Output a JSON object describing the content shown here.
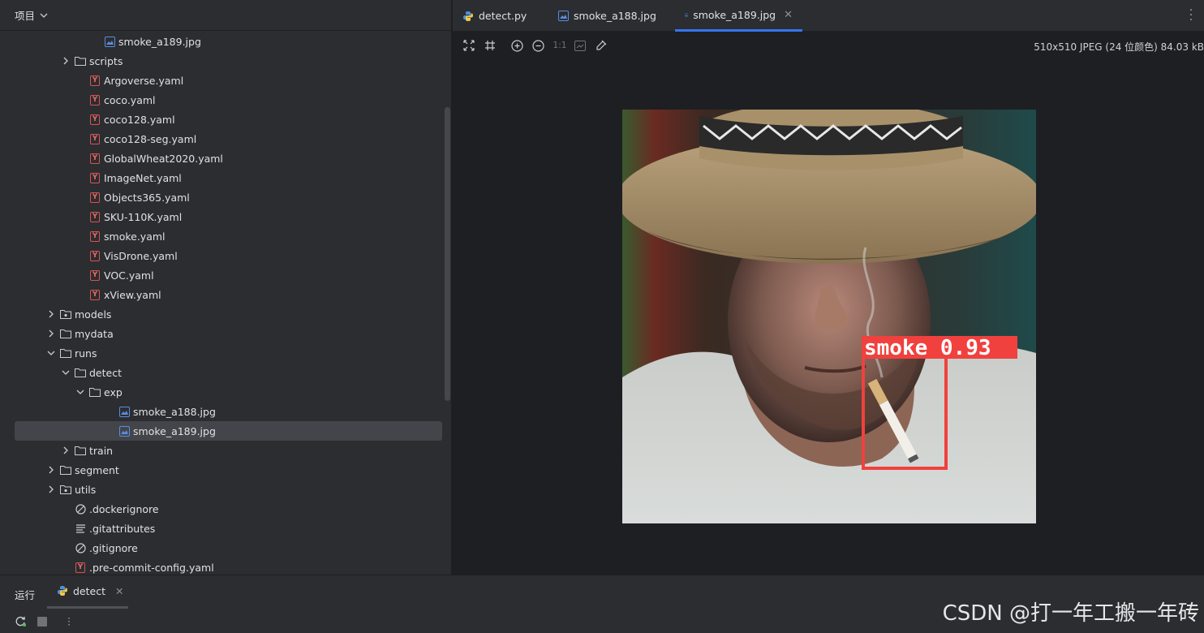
{
  "project_panel": {
    "title": "项目",
    "tree": [
      {
        "label": "smoke_a189.jpg",
        "type": "image",
        "depth": 5,
        "arrow": "none"
      },
      {
        "label": "scripts",
        "type": "folder",
        "depth": 3,
        "arrow": "right"
      },
      {
        "label": "Argoverse.yaml",
        "type": "yaml",
        "depth": 4,
        "arrow": "none"
      },
      {
        "label": "coco.yaml",
        "type": "yaml",
        "depth": 4,
        "arrow": "none"
      },
      {
        "label": "coco128.yaml",
        "type": "yaml",
        "depth": 4,
        "arrow": "none"
      },
      {
        "label": "coco128-seg.yaml",
        "type": "yaml",
        "depth": 4,
        "arrow": "none"
      },
      {
        "label": "GlobalWheat2020.yaml",
        "type": "yaml",
        "depth": 4,
        "arrow": "none"
      },
      {
        "label": "ImageNet.yaml",
        "type": "yaml",
        "depth": 4,
        "arrow": "none"
      },
      {
        "label": "Objects365.yaml",
        "type": "yaml",
        "depth": 4,
        "arrow": "none"
      },
      {
        "label": "SKU-110K.yaml",
        "type": "yaml",
        "depth": 4,
        "arrow": "none"
      },
      {
        "label": "smoke.yaml",
        "type": "yaml",
        "depth": 4,
        "arrow": "none"
      },
      {
        "label": "VisDrone.yaml",
        "type": "yaml",
        "depth": 4,
        "arrow": "none"
      },
      {
        "label": "VOC.yaml",
        "type": "yaml",
        "depth": 4,
        "arrow": "none"
      },
      {
        "label": "xView.yaml",
        "type": "yaml",
        "depth": 4,
        "arrow": "none"
      },
      {
        "label": "models",
        "type": "package",
        "depth": 2,
        "arrow": "right"
      },
      {
        "label": "mydata",
        "type": "folder",
        "depth": 2,
        "arrow": "right"
      },
      {
        "label": "runs",
        "type": "folder",
        "depth": 2,
        "arrow": "down"
      },
      {
        "label": "detect",
        "type": "folder",
        "depth": 3,
        "arrow": "down"
      },
      {
        "label": "exp",
        "type": "folder",
        "depth": 4,
        "arrow": "down"
      },
      {
        "label": "smoke_a188.jpg",
        "type": "image",
        "depth": 6,
        "arrow": "none"
      },
      {
        "label": "smoke_a189.jpg",
        "type": "image",
        "depth": 6,
        "arrow": "none",
        "selected": true
      },
      {
        "label": "train",
        "type": "folder",
        "depth": 3,
        "arrow": "right"
      },
      {
        "label": "segment",
        "type": "folder",
        "depth": 2,
        "arrow": "right"
      },
      {
        "label": "utils",
        "type": "package",
        "depth": 2,
        "arrow": "right"
      },
      {
        "label": ".dockerignore",
        "type": "ignore",
        "depth": 3,
        "arrow": "none"
      },
      {
        "label": ".gitattributes",
        "type": "text",
        "depth": 3,
        "arrow": "none"
      },
      {
        "label": ".gitignore",
        "type": "ignore",
        "depth": 3,
        "arrow": "none"
      },
      {
        "label": ".pre-commit-config.yaml",
        "type": "yaml",
        "depth": 3,
        "arrow": "none"
      }
    ]
  },
  "editor": {
    "tabs": [
      {
        "label": "detect.py",
        "icon": "python-icon",
        "active": false
      },
      {
        "label": "smoke_a188.jpg",
        "icon": "image-file-icon",
        "active": false
      },
      {
        "label": "smoke_a189.jpg",
        "icon": "image-file-icon",
        "active": true
      }
    ],
    "image_info": "510x510 JPEG (24 位颜色) 84.03 kB",
    "zoom_actual_label": "1:1",
    "detection": {
      "label": "smoke 0.93",
      "class": "smoke",
      "confidence": 0.93,
      "box_color": "#f0413e"
    }
  },
  "run_panel": {
    "title": "运行",
    "tab_label": "detect"
  },
  "watermark": "CSDN @打一年工搬一年砖",
  "colors": {
    "accent": "#3574f0",
    "panel": "#2b2d30",
    "editor_bg": "#1e1f22",
    "detection_box": "#f0413e"
  }
}
